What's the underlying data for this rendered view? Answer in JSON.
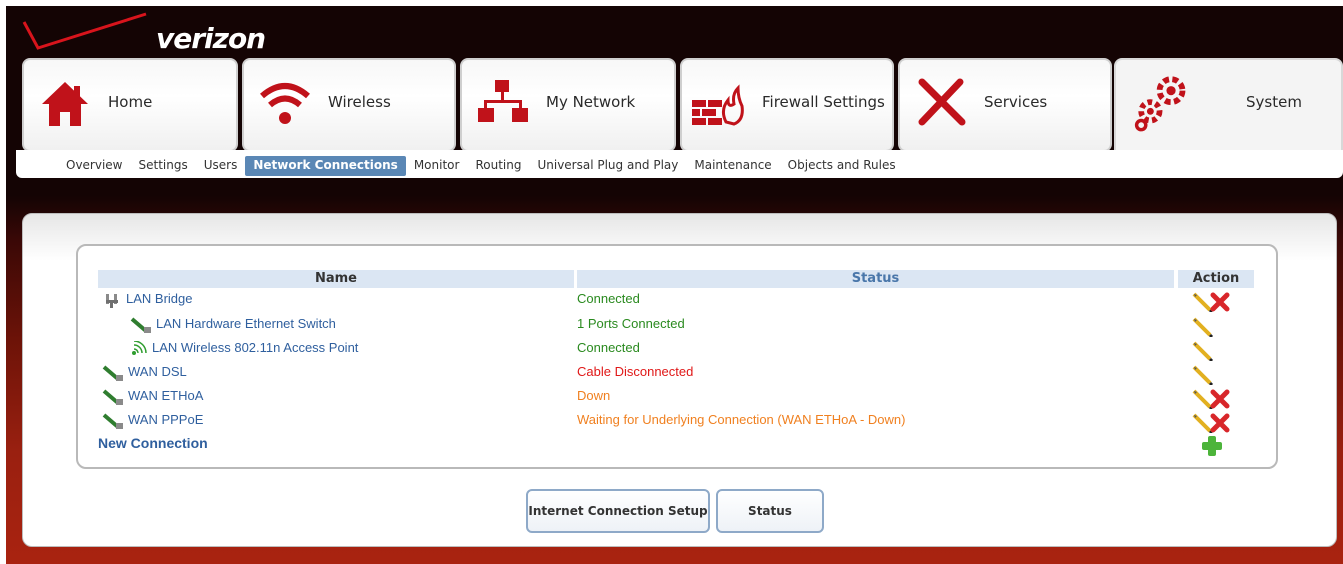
{
  "brand": {
    "logo_text": "verizon"
  },
  "tabs": [
    {
      "label": "Home",
      "icon": "home-icon"
    },
    {
      "label": "Wireless",
      "icon": "wireless-icon"
    },
    {
      "label": "My Network",
      "icon": "network-icon"
    },
    {
      "label": "Firewall Settings",
      "icon": "firewall-icon"
    },
    {
      "label": "Services",
      "icon": "tools-icon"
    },
    {
      "label": "System",
      "icon": "gears-icon"
    }
  ],
  "active_tab": "System",
  "subnav": [
    {
      "label": "Overview"
    },
    {
      "label": "Settings"
    },
    {
      "label": "Users"
    },
    {
      "label": "Network Connections"
    },
    {
      "label": "Monitor"
    },
    {
      "label": "Routing"
    },
    {
      "label": "Universal Plug and Play"
    },
    {
      "label": "Maintenance"
    },
    {
      "label": "Objects and Rules"
    }
  ],
  "active_subnav": "Network Connections",
  "table": {
    "headers": {
      "name": "Name",
      "status": "Status",
      "action": "Action"
    },
    "rows": [
      {
        "name": "LAN Bridge",
        "icon": "bridge-icon",
        "status": "Connected",
        "status_color": "#2a8a1f",
        "actions": [
          "edit",
          "delete"
        ]
      },
      {
        "name": "LAN Hardware Ethernet Switch",
        "icon": "ethernet-cable-icon",
        "status": "1 Ports Connected",
        "status_color": "#2a8a1f",
        "actions": [
          "edit"
        ]
      },
      {
        "name": "LAN Wireless 802.11n Access Point",
        "icon": "wifi-antenna-icon",
        "status": "Connected",
        "status_color": "#2a8a1f",
        "actions": [
          "edit"
        ]
      },
      {
        "name": "WAN DSL",
        "icon": "ethernet-cable-icon",
        "status": "Cable Disconnected",
        "status_color": "#e01818",
        "actions": [
          "edit"
        ]
      },
      {
        "name": "WAN ETHoA",
        "icon": "ethernet-cable-icon",
        "status": "Down",
        "status_color": "#f08020",
        "actions": [
          "edit",
          "delete"
        ]
      },
      {
        "name": "WAN PPPoE",
        "icon": "ethernet-cable-icon",
        "status": "Waiting for Underlying Connection (WAN ETHoA - Down)",
        "status_color": "#f08020",
        "actions": [
          "edit",
          "delete"
        ]
      }
    ],
    "new_connection_label": "New Connection"
  },
  "buttons": {
    "internet_setup": "Internet Connection Setup",
    "status": "Status"
  },
  "colors": {
    "link": "#2f5f9e",
    "header_bg": "#dbe6f3",
    "active_subnav_bg": "#5a87b5"
  }
}
